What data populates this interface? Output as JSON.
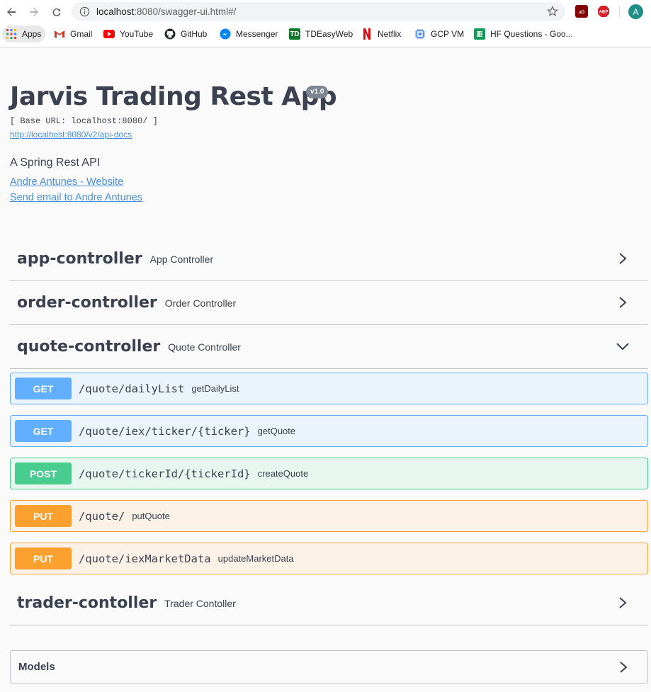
{
  "browser": {
    "url_host": "localhost",
    "url_rest": ":8080/swagger-ui.html#/",
    "avatar_letter": "A",
    "bookmarks": [
      {
        "label": "Apps",
        "icon": "apps-grid-icon"
      },
      {
        "label": "Gmail",
        "icon": "gmail-icon"
      },
      {
        "label": "YouTube",
        "icon": "youtube-icon"
      },
      {
        "label": "GitHub",
        "icon": "github-icon"
      },
      {
        "label": "Messenger",
        "icon": "messenger-icon"
      },
      {
        "label": "TDEasyWeb",
        "icon": "td-icon"
      },
      {
        "label": "Netflix",
        "icon": "netflix-icon"
      },
      {
        "label": "GCP VM",
        "icon": "gcp-chip-icon"
      },
      {
        "label": "HF Questions - Goo...",
        "icon": "sheets-icon"
      }
    ]
  },
  "info": {
    "title": "Jarvis Trading Rest App",
    "version": "v1.0",
    "base_url": "[ Base URL: localhost:8080/ ]",
    "api_docs": "http://localhost:8080/v2/api-docs",
    "description": "A Spring Rest API",
    "website_link": "Andre Antunes - Website",
    "email_link": "Send email to Andre Antunes"
  },
  "tags": [
    {
      "name": "app-controller",
      "description": "App Controller",
      "expanded": false
    },
    {
      "name": "order-controller",
      "description": "Order Controller",
      "expanded": false
    },
    {
      "name": "quote-controller",
      "description": "Quote Controller",
      "expanded": true
    },
    {
      "name": "trader-contoller",
      "description": "Trader Contoller",
      "expanded": false
    }
  ],
  "operations": [
    {
      "method": "GET",
      "path": "/quote/dailyList",
      "summary": "getDailyList"
    },
    {
      "method": "GET",
      "path": "/quote/iex/ticker/{ticker}",
      "summary": "getQuote"
    },
    {
      "method": "POST",
      "path": "/quote/tickerId/{tickerId}",
      "summary": "createQuote"
    },
    {
      "method": "PUT",
      "path": "/quote/",
      "summary": "putQuote"
    },
    {
      "method": "PUT",
      "path": "/quote/iexMarketData",
      "summary": "updateMarketData"
    }
  ],
  "models": {
    "label": "Models"
  },
  "colors": {
    "get": "#61affe",
    "post": "#49cc90",
    "put": "#fca130",
    "link": "#4990e2",
    "text": "#3b4151"
  }
}
